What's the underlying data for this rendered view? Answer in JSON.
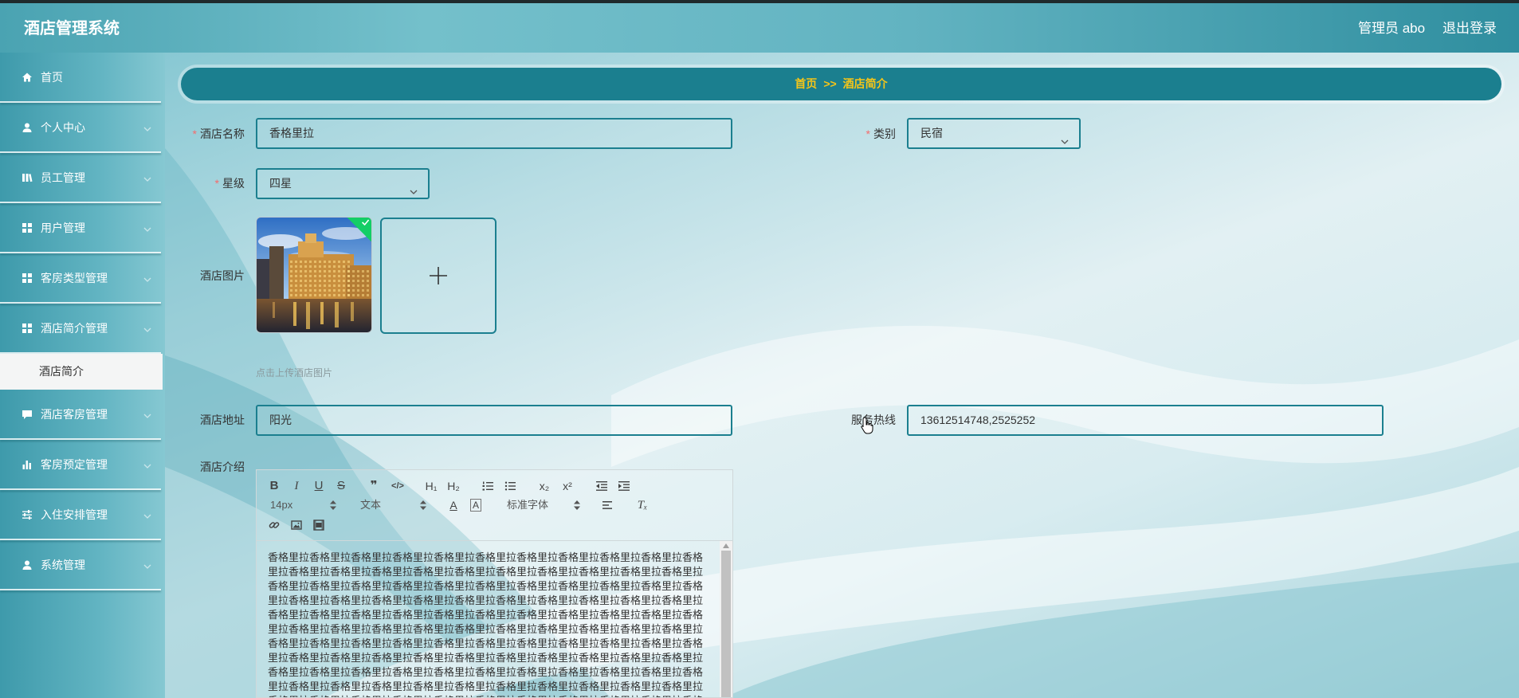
{
  "app": {
    "title": "酒店管理系统"
  },
  "header": {
    "user_label": "管理员 abo",
    "logout_label": "退出登录"
  },
  "sidebar": {
    "items": [
      {
        "label": "首页",
        "icon": "home-icon"
      },
      {
        "label": "个人中心",
        "icon": "user-icon"
      },
      {
        "label": "员工管理",
        "icon": "library-icon"
      },
      {
        "label": "用户管理",
        "icon": "grid-icon"
      },
      {
        "label": "客房类型管理",
        "icon": "grid-icon"
      },
      {
        "label": "酒店简介管理",
        "icon": "grid-icon",
        "expanded": true
      },
      {
        "label": "酒店客房管理",
        "icon": "comment-icon"
      },
      {
        "label": "客房预定管理",
        "icon": "bar-chart-icon"
      },
      {
        "label": "入住安排管理",
        "icon": "sliders-icon"
      },
      {
        "label": "系统管理",
        "icon": "user-icon"
      }
    ],
    "submenu": {
      "label": "酒店简介",
      "active": true
    }
  },
  "breadcrumb": {
    "home": "首页",
    "separator": ">>",
    "current": "酒店简介"
  },
  "form": {
    "required_mark": "*",
    "hotel_name": {
      "label": "酒店名称",
      "value": "香格里拉",
      "required": true
    },
    "category": {
      "label": "类别",
      "value": "民宿",
      "required": true
    },
    "star_level": {
      "label": "星级",
      "value": "四星",
      "required": true
    },
    "hotel_image": {
      "label": "酒店图片",
      "hint": "点击上传酒店图片",
      "uploaded": true
    },
    "address": {
      "label": "酒店地址",
      "value": "阳光"
    },
    "hotline": {
      "label": "服务热线",
      "value": "13612514748,2525252"
    },
    "intro": {
      "label": "酒店介绍",
      "toolbar": {
        "bold": "B",
        "italic": "I",
        "underline": "U",
        "strike": "S",
        "quote": "❞",
        "code": "</>",
        "h1": "H₁",
        "h2": "H₂",
        "sub": "x₂",
        "sup": "x²",
        "size": "14px",
        "header": "文本",
        "color": "A",
        "background": "A",
        "font": "标准字体",
        "clean": "Tₓ"
      },
      "content": "香格里拉香格里拉香格里拉香格里拉香格里拉香格里拉香格里拉香格里拉香格里拉香格里拉香格里拉香格里拉香格里拉香格里拉香格里拉香格里拉香格里拉香格里拉香格里拉香格里拉香格里拉香格里拉香格里拉香格里拉香格里拉香格里拉香格里拉香格里拉香格里拉香格里拉香格里拉香格里拉香格里拉香格里拉香格里拉香格里拉香格里拉香格里拉香格里拉香格里拉香格里拉香格里拉香格里拉香格里拉香格里拉香格里拉香格里拉香格里拉香格里拉香格里拉香格里拉香格里拉香格里拉香格里拉香格里拉香格里拉香格里拉香格里拉香格里拉香格里拉香格里拉香格里拉香格里拉香格里拉香格里拉香格里拉香格里拉香格里拉香格里拉香格里拉香格里拉香格里拉香格里拉香格里拉香格里拉香格里拉香格里拉香格里拉香格里拉香格里拉香格里拉香格里拉香格里拉香格里拉香格里拉香格里拉香格里拉香格里拉香格里拉香格里拉香格里拉香格里拉香格里拉香格里拉香格里拉香格里拉香格里拉香格里拉香格里拉香格里拉香格里拉香格里拉香格里拉香格里拉香格里拉香格里拉香格里拉香格里拉香格里拉香格里拉香格里拉香格里拉香格里拉香格里拉香格里拉香格里拉香格里拉香格里拉"
    }
  },
  "colors": {
    "header": "#3d9cad",
    "breadcrumb_bg": "#1b7f8f",
    "breadcrumb_text": "#f5c518",
    "input_border": "#1b7f8f",
    "required": "#f56c6c",
    "success": "#13ce66"
  }
}
